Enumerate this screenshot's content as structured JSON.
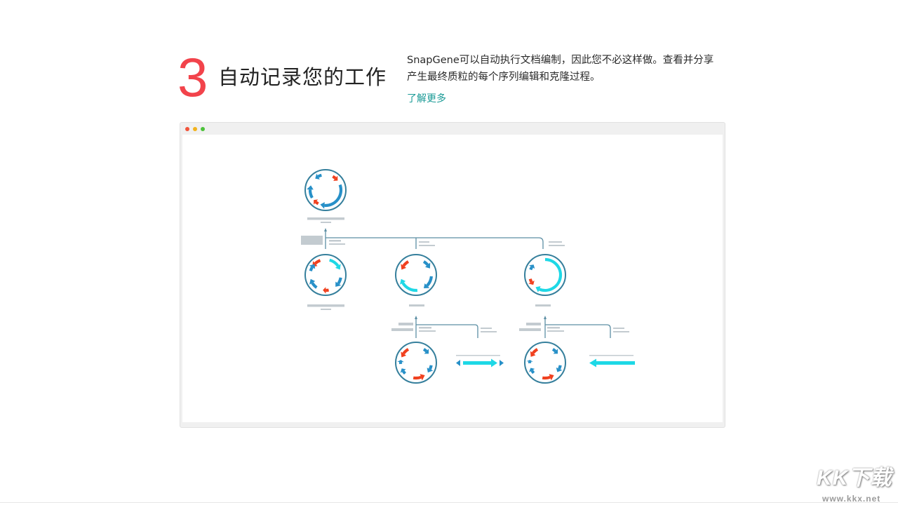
{
  "feature": {
    "number": "3",
    "title": "自动记录您的工作",
    "description": "SnapGene可以自动执行文档编制，因此您不必这样做。查看并分享产生最终质粒的每个序列编辑和克隆过程。",
    "learn_more": "了解更多"
  },
  "colors": {
    "accent_number": "#f2434b",
    "link": "#1a9a96",
    "window_dot_red": "#f2543a",
    "window_dot_yellow": "#f2b21c",
    "window_dot_green": "#4cc23a",
    "plasmid_ring": "#357f9c",
    "feature_blue": "#2790c8",
    "feature_red": "#f0401e",
    "feature_cyan": "#1ed8e6",
    "tree_line": "#5c8fa4",
    "placeholder_gray": "#c3cbd0"
  },
  "icons": {
    "plasmid": "plasmid-map-icon",
    "linear": "linear-fragment-icon"
  },
  "watermark": {
    "text": "KK下载",
    "url": "www.kkx.net"
  }
}
